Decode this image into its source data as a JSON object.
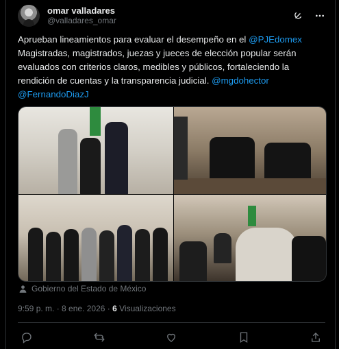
{
  "author": {
    "display_name": "omar valladares",
    "handle": "@valladares_omar"
  },
  "post": {
    "text_1": "Aprueban lineamientos para evaluar el desempeño en el ",
    "mention_1": "@PJEdomex",
    "text_2": " Magistradas, magistrados, juezas y jueces de elección popular serán evaluados con criterios claros, medibles y públicos, fortaleciendo la rendición de cuentas y la transparencia judicial. ",
    "mention_2": "@mgdohector",
    "mention_3": "@FernandoDiazJ"
  },
  "media_caption": "Gobierno del Estado de México",
  "meta": {
    "time_date": "9:59 p. m. · 8 ene. 2026 · ",
    "views_count": "6",
    "views_label": " Visualizaciones"
  },
  "icons": {
    "grok": "grok-icon",
    "more": "more-icon",
    "reply": "reply-icon",
    "repost": "repost-icon",
    "like": "like-icon",
    "bookmark": "bookmark-icon",
    "share": "share-icon"
  },
  "colors": {
    "background": "#000000",
    "text": "#e7e9ea",
    "muted": "#71767b",
    "link": "#1d9bf0",
    "border": "#2f3336"
  }
}
